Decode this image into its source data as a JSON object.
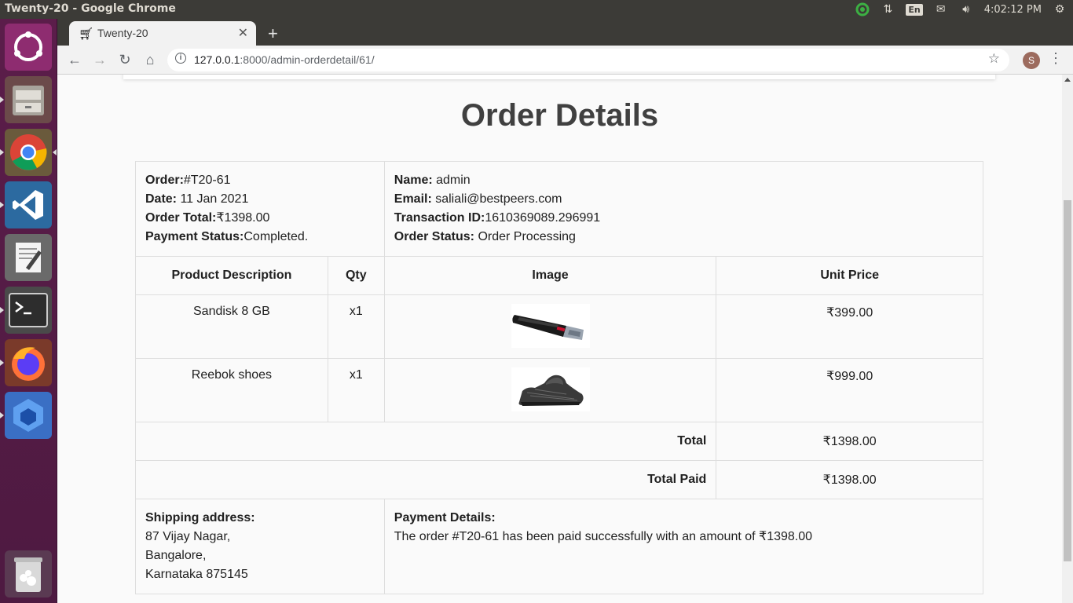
{
  "os": {
    "window_title": "Twenty-20 - Google Chrome",
    "language": "En",
    "clock": "4:02:12 PM"
  },
  "browser": {
    "tab_title": "Twenty-20",
    "url_host": "127.0.0.1",
    "url_path": ":8000/admin-orderdetail/61/",
    "profile_initial": "S"
  },
  "page": {
    "title": "Order Details",
    "order_label": "Order:",
    "order_value": "#T20-61",
    "date_label": "Date:",
    "date_value": " 11 Jan 2021",
    "total_label": "Order Total:",
    "total_value": "₹1398.00",
    "payment_status_label": "Payment Status:",
    "payment_status_value": "Completed.",
    "name_label": "Name:",
    "name_value": " admin",
    "email_label": "Email:",
    "email_value": " saliali@bestpeers.com",
    "transaction_label": "Transaction ID:",
    "transaction_value": "1610369089.296991",
    "order_status_label": "Order Status:",
    "order_status_value": " Order Processing",
    "columns": [
      "Product Description",
      "Qty",
      "Image",
      "Unit Price"
    ],
    "items": [
      {
        "name": "Sandisk 8 GB",
        "qty": "x1",
        "price": "₹399.00",
        "image": "usb-drive"
      },
      {
        "name": "Reebok shoes",
        "qty": "x1",
        "price": "₹999.00",
        "image": "shoe"
      }
    ],
    "total_row_label": "Total",
    "total_row_value": "₹1398.00",
    "total_paid_label": "Total Paid",
    "total_paid_value": "₹1398.00",
    "shipping_label": "Shipping address:",
    "shipping_line1": "87 Vijay Nagar,",
    "shipping_line2": "Bangalore,",
    "shipping_line3": "Karnataka 875145",
    "payment_details_label": "Payment Details:",
    "payment_details_text": "The order #T20-61 has been paid successfully with an amount of ₹1398.00"
  },
  "colors": {
    "topbar": "#3c3b37",
    "launcher": "#5b1d4a",
    "border": "#dedede"
  }
}
